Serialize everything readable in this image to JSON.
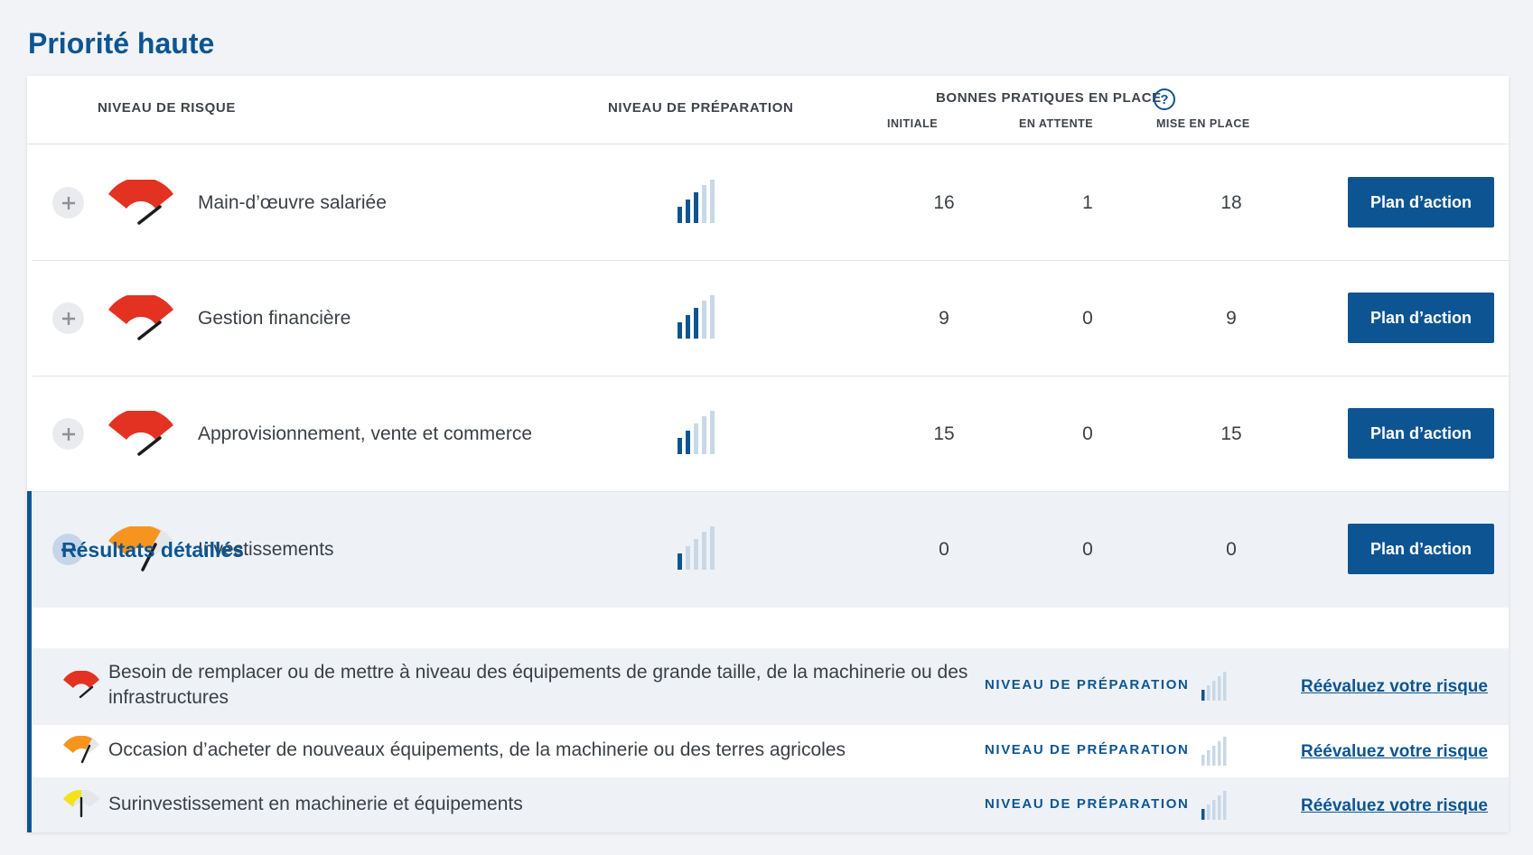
{
  "section_title": "Priorité haute",
  "header": {
    "risk_level": "NIVEAU DE RISQUE",
    "preparation_level": "NIVEAU DE PRÉPARATION",
    "best_practices": "BONNES PRATIQUES EN PLACE",
    "help_icon": "?",
    "col_initial": "INITIALE",
    "col_pending": "EN ATTENTE",
    "col_done": "MISE EN PLACE"
  },
  "rows": [
    {
      "name": "Main-d’œuvre salariée",
      "initial": "16",
      "pending": "1",
      "done": "18",
      "button": "Plan d’action",
      "risk_color": "#e43222",
      "preparation_bars_filled": 3,
      "expanded": false
    },
    {
      "name": "Gestion financière",
      "initial": "9",
      "pending": "0",
      "done": "9",
      "button": "Plan d’action",
      "risk_color": "#e43222",
      "preparation_bars_filled": 3,
      "expanded": false
    },
    {
      "name": "Approvisionnement, vente et commerce",
      "initial": "15",
      "pending": "0",
      "done": "15",
      "button": "Plan d’action",
      "risk_color": "#e43222",
      "preparation_bars_filled": 2,
      "expanded": false
    },
    {
      "name": "Investissements",
      "initial": "0",
      "pending": "0",
      "done": "0",
      "button": "Plan d’action",
      "risk_color": "#f7941d",
      "preparation_bars_filled": 1,
      "expanded": true
    }
  ],
  "details": {
    "title": "Résultats détaillés",
    "items": [
      {
        "text_line1": "Besoin de remplacer ou de mettre à niveau des équipements de grande taille, de la machinerie ou des",
        "text_line2": "infrastructures",
        "prep_label": "NIVEAU DE PRÉPARATION",
        "link": "Réévaluez votre risque",
        "risk_color": "#e43222"
      },
      {
        "text_line1": "Occasion d’acheter de nouveaux équipements, de la machinerie ou des terres agricoles",
        "text_line2": "",
        "prep_label": "NIVEAU DE PRÉPARATION",
        "link": "Réévaluez votre risque",
        "risk_color": "#f7941d"
      },
      {
        "text_line1": "Surinvestissement en machinerie et équipements",
        "text_line2": "",
        "prep_label": "NIVEAU DE PRÉPARATION",
        "link": "Réévaluez votre risque",
        "risk_color": "#f5e11b"
      }
    ]
  },
  "colors": {
    "primary": "#0d5592",
    "high_risk": "#e43222",
    "medium_risk": "#f7941d",
    "low_risk": "#f5e11b",
    "bar_empty": "#c9d8e6"
  }
}
